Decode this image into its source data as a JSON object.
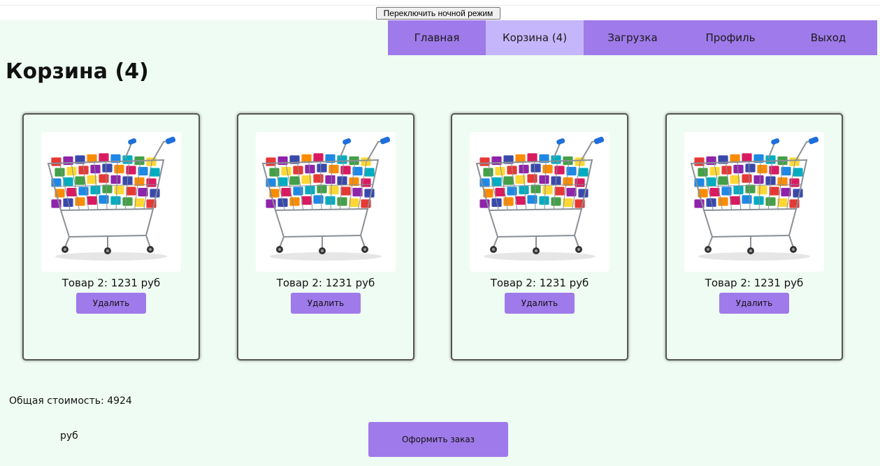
{
  "toolbar": {
    "night_mode_label": "Переключить ночной режим"
  },
  "nav": {
    "items": [
      {
        "label": "Главная",
        "active": false
      },
      {
        "label": "Корзина (4)",
        "active": true
      },
      {
        "label": "Загрузка",
        "active": false
      },
      {
        "label": "Профиль",
        "active": false
      },
      {
        "label": "Выход",
        "active": false
      }
    ]
  },
  "page": {
    "title": "Корзина (4)"
  },
  "cart": {
    "items": [
      {
        "caption": "Товар 2: 1231 руб",
        "image": "shopping-cart-with-app-icons",
        "delete_label": "Удалить"
      },
      {
        "caption": "Товар 2: 1231 руб",
        "image": "shopping-cart-with-app-icons",
        "delete_label": "Удалить"
      },
      {
        "caption": "Товар 2: 1231 руб",
        "image": "shopping-cart-with-app-icons",
        "delete_label": "Удалить"
      },
      {
        "caption": "Товар 2: 1231 руб",
        "image": "shopping-cart-with-app-icons",
        "delete_label": "Удалить"
      }
    ],
    "total_label": "Общая стоимость: 4924",
    "total_currency": "руб",
    "order_label": "Оформить заказ"
  },
  "colors": {
    "accent": "#9f7aea",
    "accent_active": "#c5b6fb",
    "background": "#effcf3"
  }
}
